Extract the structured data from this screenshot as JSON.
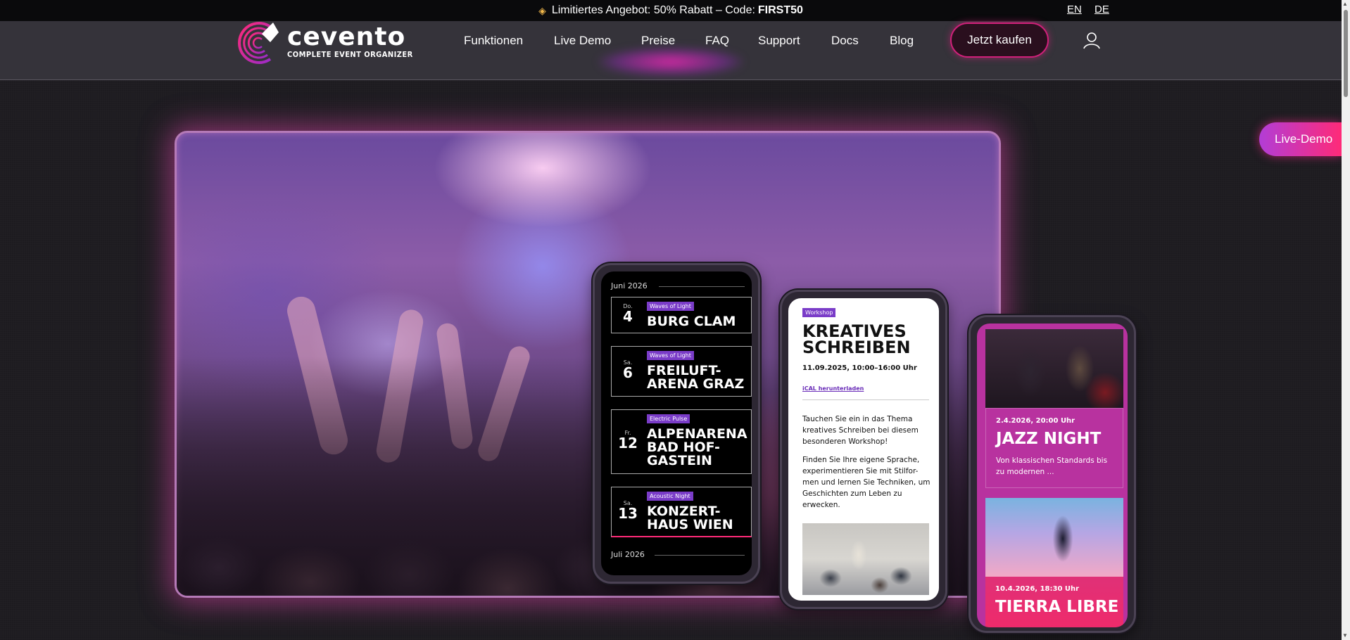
{
  "promo": {
    "icon": "tag-icon",
    "text": "Limitiertes Angebot: 50% Rabatt – Code:",
    "code": "FIRST50"
  },
  "languages": [
    "EN",
    "DE"
  ],
  "logo": {
    "word": "cevento",
    "subtitle": "COMPLETE EVENT ORGANIZER"
  },
  "nav": {
    "items": [
      "Funktionen",
      "Live Demo",
      "Preise",
      "FAQ",
      "Support",
      "Docs",
      "Blog"
    ],
    "cta": "Jetzt kaufen",
    "user_icon": "user-icon"
  },
  "side_tab": {
    "label": "Live-Demo"
  },
  "phone1": {
    "month1": "Juni 2026",
    "month2": "Juli 2026",
    "events": [
      {
        "weekday": "Do.",
        "day": "4",
        "tag": "Waves of Light",
        "title": "BURG CLAM"
      },
      {
        "weekday": "Sa.",
        "day": "6",
        "tag": "Waves of Light",
        "title": "FREILUFT-ARENA GRAZ"
      },
      {
        "weekday": "Fr.",
        "day": "12",
        "tag": "Electric Pulse",
        "title": "ALPENARENA BAD HOF-GASTEIN"
      },
      {
        "weekday": "Sa.",
        "day": "13",
        "tag": "Acoustic Night",
        "title": "KONZERT-HAUS WIEN"
      }
    ]
  },
  "phone2": {
    "tag": "Workshop",
    "title": "KREATIVES SCHREIBEN",
    "date": "11.09.2025, 10:00–16:00 Uhr",
    "ical": "iCAL herunterladen",
    "text1": "Tauchen Sie ein in das Thema kreatives Schreiben bei diesem besonderen Workshop!",
    "text2": "Finden Sie Ihre eigene Sprache, experimentieren Sie mit Stilfor-men und lernen Sie Techniken, um Geschichten zum Leben zu erwecken."
  },
  "phone3": {
    "cards": [
      {
        "date": "2.4.2026, 20:00 Uhr",
        "title": "JAZZ NIGHT",
        "desc": "Von klassischen Standards bis zu modernen ..."
      },
      {
        "date": "10.4.2026, 18:30 Uhr",
        "title": "TIERRA LIBRE",
        "desc": ""
      }
    ]
  },
  "colors": {
    "accent_pink": "#ff2a78",
    "accent_purple": "#7a3cc8",
    "header_bg": "#35333a",
    "page_bg": "#1d1b20"
  }
}
